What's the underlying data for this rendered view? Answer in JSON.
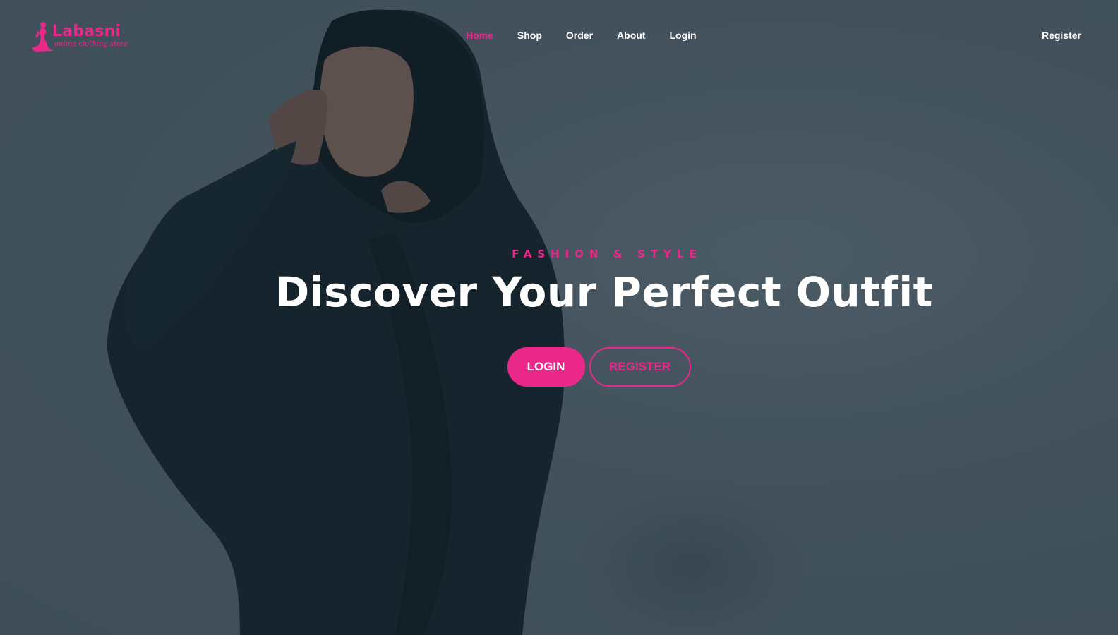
{
  "brand": {
    "name": "Labasni",
    "tagline": "online clothing store",
    "accent_color": "#e9288a"
  },
  "nav": {
    "items": [
      {
        "label": "Home",
        "active": true
      },
      {
        "label": "Shop",
        "active": false
      },
      {
        "label": "Order",
        "active": false
      },
      {
        "label": "About",
        "active": false
      },
      {
        "label": "Login",
        "active": false
      }
    ],
    "register_label": "Register"
  },
  "hero": {
    "eyebrow": "FASHION & STYLE",
    "headline": "Discover Your Perfect Outfit",
    "login_button": "LOGIN",
    "register_button": "REGISTER",
    "background_image": "woman-in-black-hijab-photo"
  },
  "icons": {
    "logo": "dress-figure-icon"
  }
}
